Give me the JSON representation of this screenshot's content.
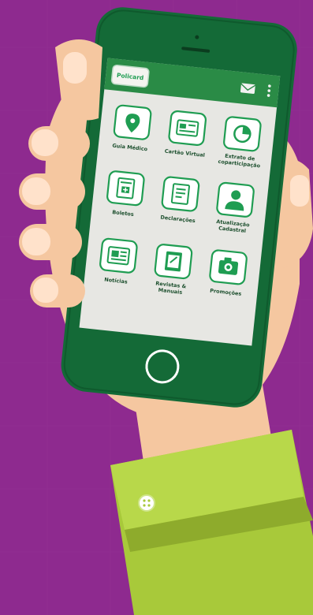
{
  "colors": {
    "background": "#8e2a8f",
    "phone_body": "#146a37",
    "phone_screen": "#e7e7e3",
    "app_bar": "#2a8b46",
    "tile_green": "#1f9d52",
    "skin": "#f5c7a0",
    "sleeve": "#a8c93a",
    "sleeve_dark": "#8eab2c"
  },
  "app": {
    "logo_text": "Policard",
    "mail_icon": "mail-icon",
    "menu_icon": "more-vertical-icon"
  },
  "tiles": [
    {
      "label": "Guia Médico",
      "icon": "map-pin-icon"
    },
    {
      "label": "Cartão Virtual",
      "icon": "card-icon"
    },
    {
      "label": "Extrato de coparticipação",
      "icon": "pie-chart-icon"
    },
    {
      "label": "Boletos",
      "icon": "invoice-icon"
    },
    {
      "label": "Declarações",
      "icon": "document-icon"
    },
    {
      "label": "Atualização Cadastral",
      "icon": "user-icon"
    },
    {
      "label": "Notícias",
      "icon": "news-icon"
    },
    {
      "label": "Revistas & Manuais",
      "icon": "manual-icon"
    },
    {
      "label": "Promoções",
      "icon": "camera-icon"
    }
  ]
}
